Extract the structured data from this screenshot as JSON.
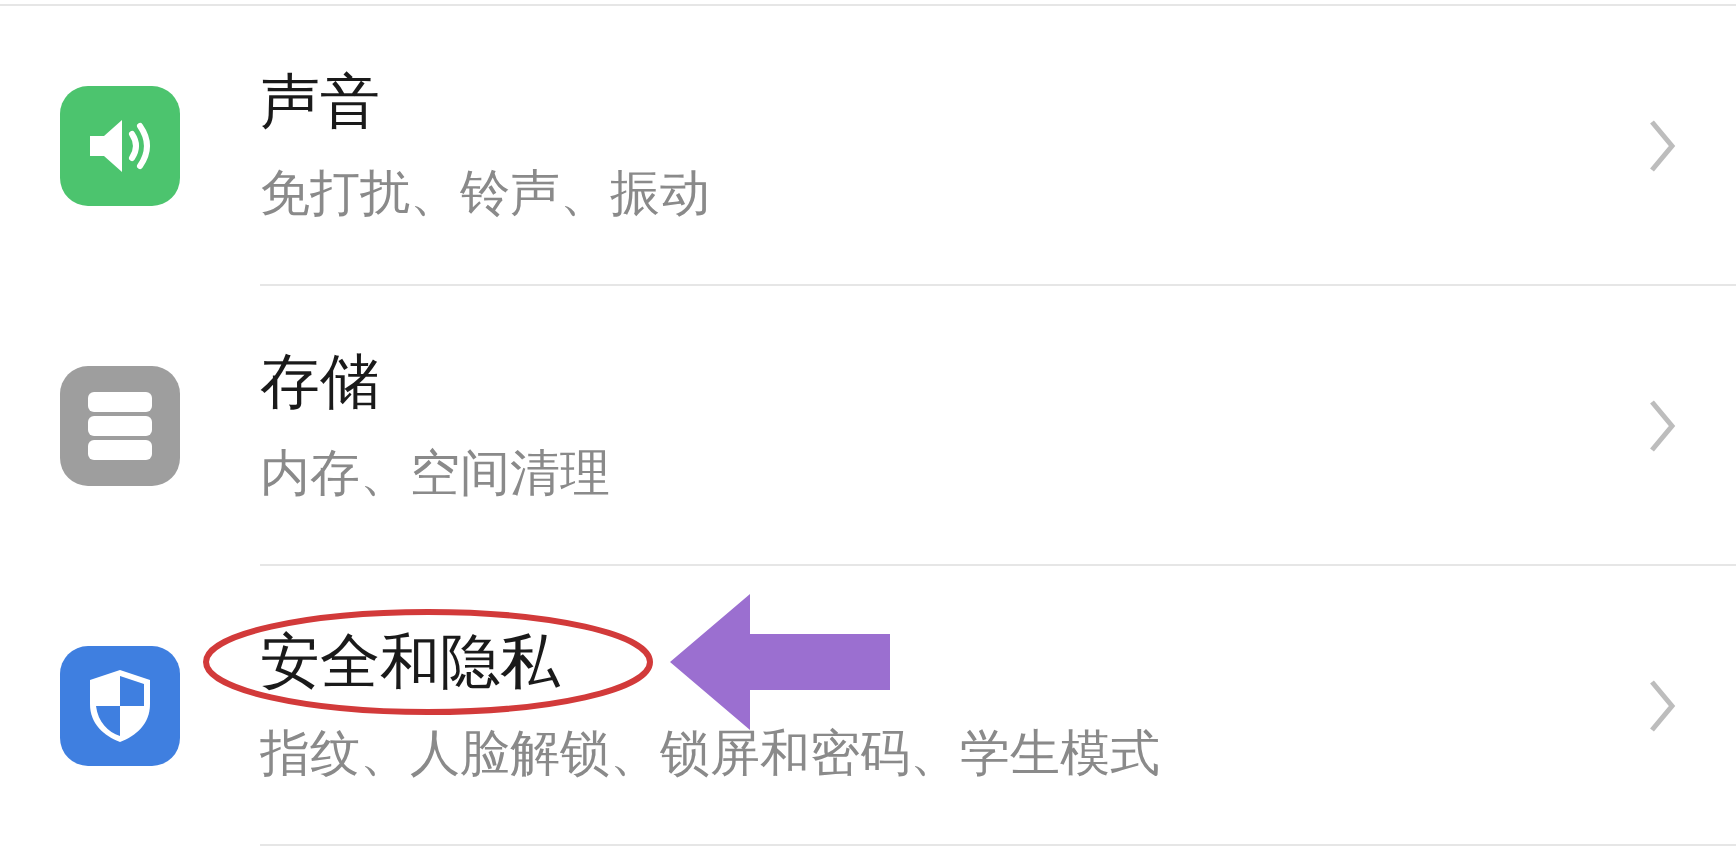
{
  "settings_items": [
    {
      "kind": "sound",
      "title": "声音",
      "subtitle": "免打扰、铃声、振动",
      "highlighted": false
    },
    {
      "kind": "storage",
      "title": "存储",
      "subtitle": "内存、空间清理",
      "highlighted": false
    },
    {
      "kind": "security",
      "title": "安全和隐私",
      "subtitle": "指纹、人脸解锁、锁屏和密码、学生模式",
      "highlighted": true
    }
  ]
}
